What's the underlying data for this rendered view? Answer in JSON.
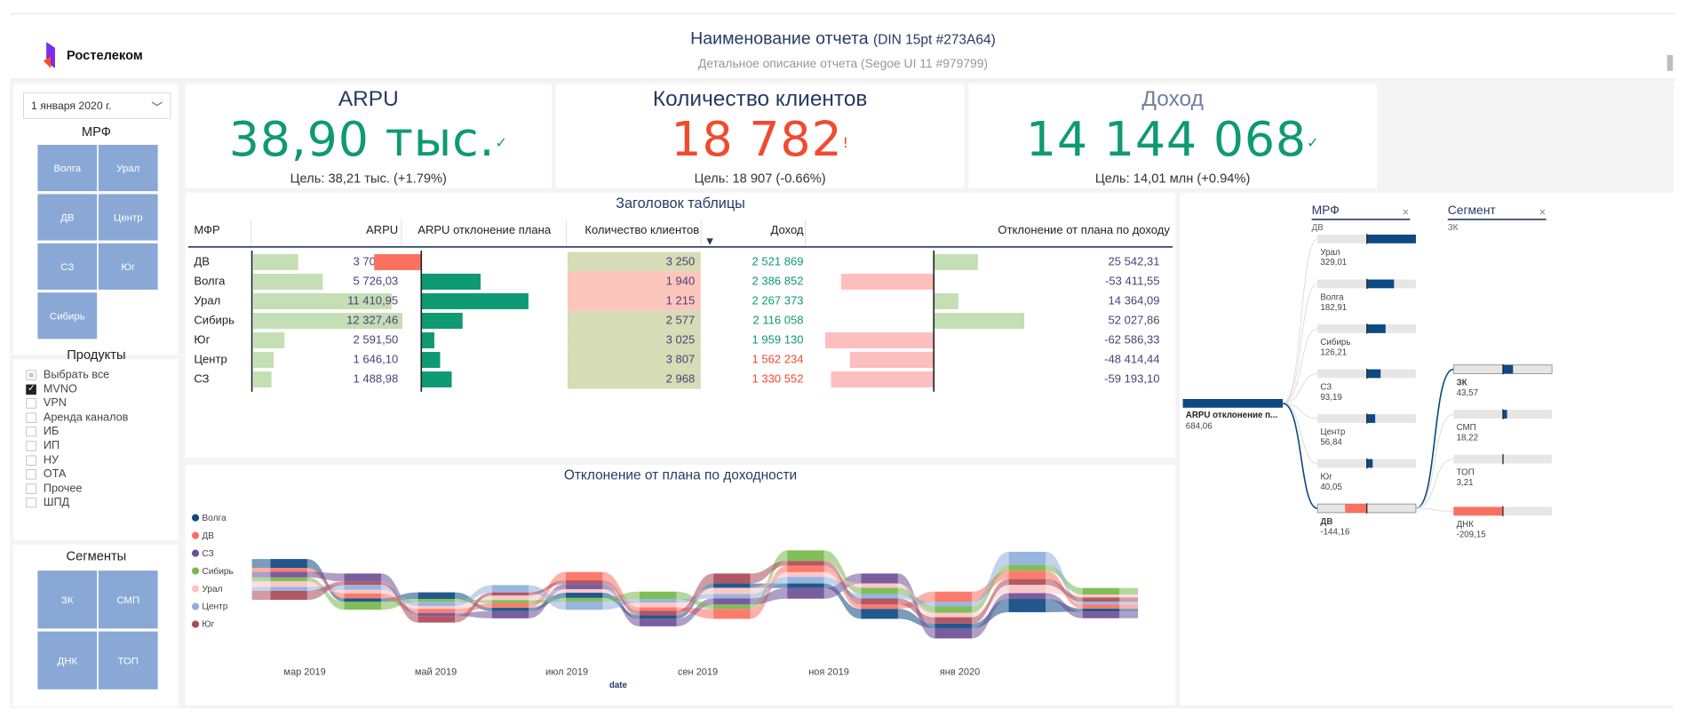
{
  "header": {
    "logo_text": "Ростелеком",
    "title": "Наименование отчета",
    "title_note": "(DIN 15pt #273A64)",
    "subtitle": "Детальное описание отчета (Segoe UI 11 #979799)"
  },
  "sidebar": {
    "date_value": "1 января 2020 г.",
    "mrf_title": "МРФ",
    "mrf_tiles": [
      "Волга",
      "Урал",
      "ДВ",
      "Центр",
      "СЗ",
      "Юг",
      "Сибирь"
    ],
    "products_title": "Продукты",
    "products": [
      {
        "label": "Выбрать все",
        "state": "partial"
      },
      {
        "label": "MVNO",
        "state": "checked"
      },
      {
        "label": "VPN",
        "state": "off"
      },
      {
        "label": "Аренда каналов",
        "state": "off"
      },
      {
        "label": "ИБ",
        "state": "off"
      },
      {
        "label": "ИП",
        "state": "off"
      },
      {
        "label": "НУ",
        "state": "off"
      },
      {
        "label": "ОТА",
        "state": "off"
      },
      {
        "label": "Прочее",
        "state": "off"
      },
      {
        "label": "ШПД",
        "state": "off"
      }
    ],
    "segments_title": "Сегменты",
    "segment_tiles": [
      "ЗК",
      "СМП",
      "ДНК",
      "ТОП"
    ]
  },
  "kpis": [
    {
      "title": "ARPU",
      "value": "38,90 тыс.",
      "check": "✓",
      "goal": "Цель: 38,21 тыс. (+1.79%)",
      "value_color": "#0e9a72",
      "title_color": "#273A64"
    },
    {
      "title": "Количество клиентов",
      "value": "18 782",
      "check": "!",
      "goal": "Цель: 18 907 (-0.66%)",
      "value_color": "#f04a2f",
      "title_color": "#273A64"
    },
    {
      "title": "Доход",
      "value": "14 144 068",
      "check": "✓",
      "goal": "Цель: 14,01 млн (+0.94%)",
      "value_color": "#0e9a72",
      "title_color": "#6f7f9f"
    }
  ],
  "table": {
    "title": "Заголовок таблицы",
    "columns": [
      "МФР",
      "ARPU",
      "ARPU отклонение плана",
      "Количество клиентов",
      "Доход",
      "Отклонение от плана по доходу"
    ],
    "rows": [
      {
        "mfr": "ДВ",
        "arpu": "3 704,00",
        "arpu_v": 3704,
        "arpu_dev": -144.06,
        "clients": "3 250",
        "clients_good": true,
        "income": "2 521 869",
        "income_good": true,
        "inc_dev": "25 542,31",
        "inc_dev_v": 25542.31
      },
      {
        "mfr": "Волга",
        "arpu": "5 726,03",
        "arpu_v": 5726.03,
        "arpu_dev": 182.91,
        "clients": "1 940",
        "clients_good": false,
        "income": "2 386 852",
        "income_good": true,
        "inc_dev": "-53 411,55",
        "inc_dev_v": -53411.55
      },
      {
        "mfr": "Урал",
        "arpu": "11 410,95",
        "arpu_v": 11410.95,
        "arpu_dev": 329.01,
        "clients": "1 215",
        "clients_good": false,
        "income": "2 267 373",
        "income_good": true,
        "inc_dev": "14 364,09",
        "inc_dev_v": 14364.09
      },
      {
        "mfr": "Сибирь",
        "arpu": "12 327,46",
        "arpu_v": 12327.46,
        "arpu_dev": 126.21,
        "clients": "2 577",
        "clients_good": true,
        "income": "2 116 058",
        "income_good": true,
        "inc_dev": "52 027,86",
        "inc_dev_v": 52027.86
      },
      {
        "mfr": "Юг",
        "arpu": "2 591,50",
        "arpu_v": 2591.5,
        "arpu_dev": 40.05,
        "clients": "3 025",
        "clients_good": true,
        "income": "1 959 130",
        "income_good": true,
        "inc_dev": "-62 586,33",
        "inc_dev_v": -62586.33
      },
      {
        "mfr": "Центр",
        "arpu": "1 646,10",
        "arpu_v": 1646.1,
        "arpu_dev": 56.84,
        "clients": "3 807",
        "clients_good": true,
        "income": "1 562 234",
        "income_good": false,
        "inc_dev": "-48 414,44",
        "inc_dev_v": -48414.44
      },
      {
        "mfr": "СЗ",
        "arpu": "1 488,98",
        "arpu_v": 1488.98,
        "arpu_dev": 93.19,
        "clients": "2 968",
        "clients_good": true,
        "income": "1 330 552",
        "income_good": false,
        "inc_dev": "-59 193,10",
        "inc_dev_v": -59193.1
      }
    ]
  },
  "chart_data": {
    "type": "area",
    "title": "Отклонение от плана по доходности",
    "xlabel": "date",
    "ylabel": "",
    "x_ticks": [
      "мар 2019",
      "май 2019",
      "июл 2019",
      "сен 2019",
      "ноя 2019",
      "янв 2020"
    ],
    "legend": [
      {
        "name": "Волга",
        "color": "#0d4a82"
      },
      {
        "name": "ДВ",
        "color": "#fd7060"
      },
      {
        "name": "СЗ",
        "color": "#6d4f97"
      },
      {
        "name": "Сибирь",
        "color": "#76b84a"
      },
      {
        "name": "Урал",
        "color": "#fbc3c3"
      },
      {
        "name": "Центр",
        "color": "#8fafdc"
      },
      {
        "name": "Юг",
        "color": "#ac4957"
      }
    ],
    "legend_position": "left",
    "chart_subtype": "ribbon",
    "periods": 12
  },
  "decomposition": {
    "root": {
      "label": "ARPU отклонение п...",
      "value": "684,06"
    },
    "mrf": {
      "title": "МРФ",
      "filter": "ДВ",
      "items": [
        {
          "label": "Урал",
          "value": "329,01",
          "v": 329.01
        },
        {
          "label": "Волга",
          "value": "182,91",
          "v": 182.91
        },
        {
          "label": "Сибирь",
          "value": "126,21",
          "v": 126.21
        },
        {
          "label": "СЗ",
          "value": "93,19",
          "v": 93.19
        },
        {
          "label": "Центр",
          "value": "56,84",
          "v": 56.84
        },
        {
          "label": "Юг",
          "value": "40,05",
          "v": 40.05
        },
        {
          "label": "ДВ",
          "value": "-144,16",
          "v": -144.16,
          "selected": true
        }
      ]
    },
    "segment": {
      "title": "Сегмент",
      "filter": "ЗК",
      "items": [
        {
          "label": "ЗК",
          "value": "43,57",
          "v": 43.57,
          "selected": true
        },
        {
          "label": "СМП",
          "value": "18,22",
          "v": 18.22
        },
        {
          "label": "ТОП",
          "value": "3,21",
          "v": 3.21
        },
        {
          "label": "ДНК",
          "value": "-209,15",
          "v": -209.15
        }
      ]
    },
    "close_icon": "×"
  },
  "colors": {
    "title": "#273A64",
    "good": "#0e9a72",
    "bad": "#f04a2f",
    "tile": "#89a8d6",
    "decomp_bar": "#0d4a82",
    "neg_bar": "#fd7060"
  }
}
